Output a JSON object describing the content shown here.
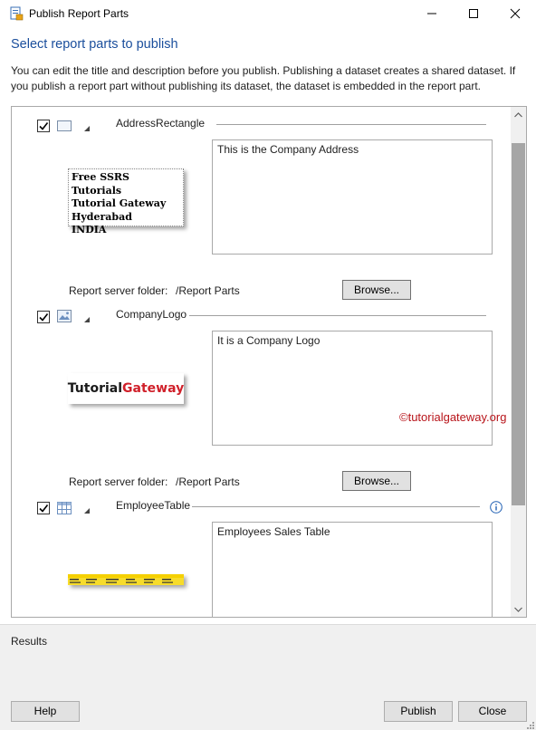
{
  "window": {
    "title": "Publish Report Parts"
  },
  "header": {
    "heading": "Select report parts to publish",
    "description": "You can edit the title and description before you publish. Publishing a dataset creates a shared dataset. If you publish a report part without publishing its dataset, the dataset is embedded in the report part."
  },
  "parts": [
    {
      "name": "AddressRectangle",
      "checked": true,
      "type_icon": "rectangle-icon",
      "description": "This is the Company Address",
      "thumbnail_lines": [
        "Free SSRS Tutorials",
        "Tutorial Gateway",
        "Hyderabad",
        "INDIA"
      ],
      "folder_label": "Report server folder:",
      "folder_value": "/Report Parts",
      "browse_label": "Browse..."
    },
    {
      "name": "CompanyLogo",
      "checked": true,
      "type_icon": "image-icon",
      "description": "It is a Company Logo",
      "thumbnail_logo": {
        "part1": "Tutorial",
        "part2": "Gateway",
        "color1": "#1a1a1a",
        "color2": "#d0202a"
      },
      "folder_label": "Report server folder:",
      "folder_value": "/Report Parts",
      "browse_label": "Browse..."
    },
    {
      "name": "EmployeeTable",
      "checked": true,
      "type_icon": "table-icon",
      "description": "Employees Sales Table",
      "has_info": true
    }
  ],
  "watermark": "©tutorialgateway.org",
  "results": {
    "label": "Results"
  },
  "buttons": {
    "help": "Help",
    "publish": "Publish",
    "close": "Close"
  },
  "colors": {
    "heading": "#1a4e9c",
    "watermark": "#b8141a",
    "table_header": "#f5d000"
  }
}
